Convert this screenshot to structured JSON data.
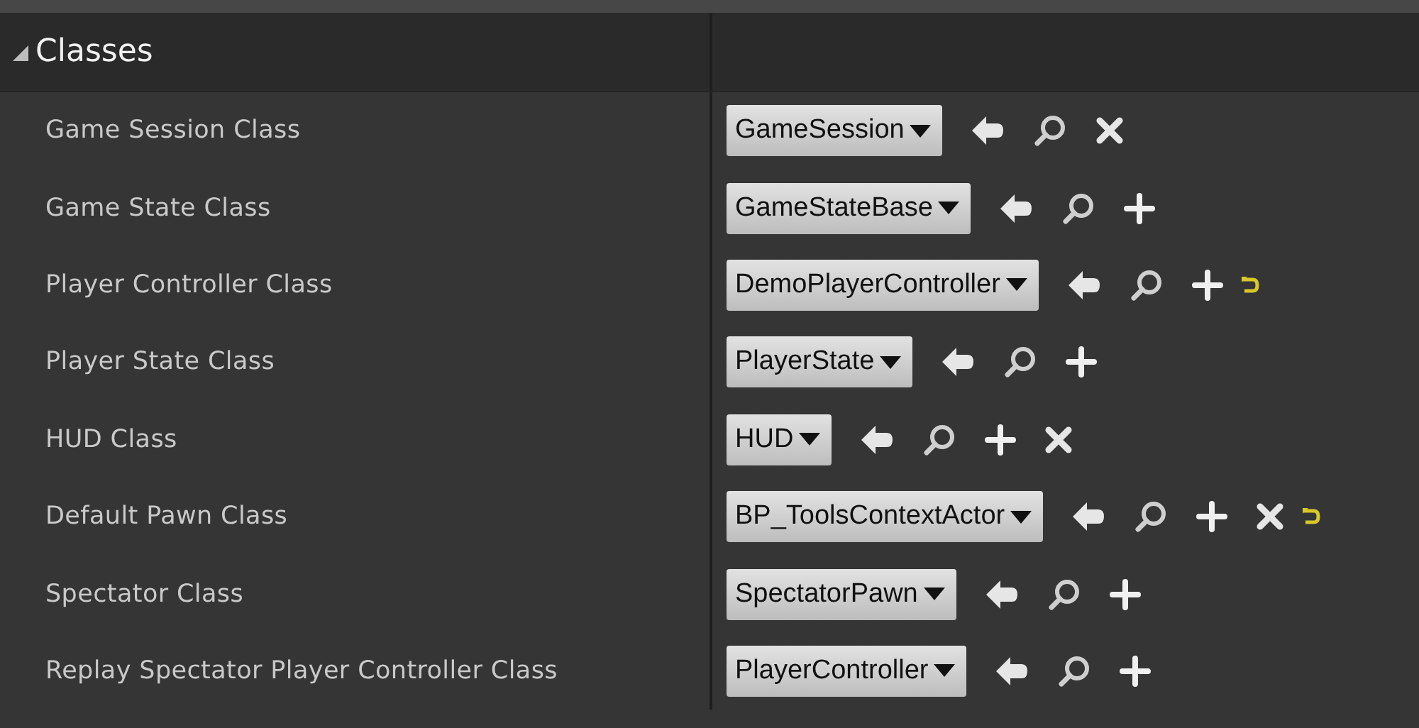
{
  "section": {
    "title": "Classes",
    "expanded": true
  },
  "rows": [
    {
      "label": "Game Session Class",
      "value": "GameSession",
      "actions": [
        {
          "kind": "use"
        },
        {
          "kind": "browse"
        },
        {
          "kind": "clear"
        }
      ]
    },
    {
      "label": "Game State Class",
      "value": "GameStateBase",
      "actions": [
        {
          "kind": "use"
        },
        {
          "kind": "browse"
        },
        {
          "kind": "add"
        }
      ]
    },
    {
      "label": "Player Controller Class",
      "value": "DemoPlayerController",
      "actions": [
        {
          "kind": "use"
        },
        {
          "kind": "browse"
        },
        {
          "kind": "add"
        },
        {
          "kind": "reset"
        }
      ]
    },
    {
      "label": "Player State Class",
      "value": "PlayerState",
      "actions": [
        {
          "kind": "use"
        },
        {
          "kind": "browse"
        },
        {
          "kind": "add"
        }
      ]
    },
    {
      "label": "HUD Class",
      "value": "HUD",
      "actions": [
        {
          "kind": "use"
        },
        {
          "kind": "browse"
        },
        {
          "kind": "add"
        },
        {
          "kind": "clear"
        }
      ]
    },
    {
      "label": "Default Pawn Class",
      "value": "BP_ToolsContextActor",
      "actions": [
        {
          "kind": "use"
        },
        {
          "kind": "browse"
        },
        {
          "kind": "add"
        },
        {
          "kind": "clear"
        },
        {
          "kind": "reset"
        }
      ]
    },
    {
      "label": "Spectator Class",
      "value": "SpectatorPawn",
      "actions": [
        {
          "kind": "use"
        },
        {
          "kind": "browse"
        },
        {
          "kind": "add"
        }
      ]
    },
    {
      "label": "Replay Spectator Player Controller Class",
      "value": "PlayerController",
      "actions": [
        {
          "kind": "use"
        },
        {
          "kind": "browse"
        },
        {
          "kind": "add"
        }
      ]
    }
  ]
}
